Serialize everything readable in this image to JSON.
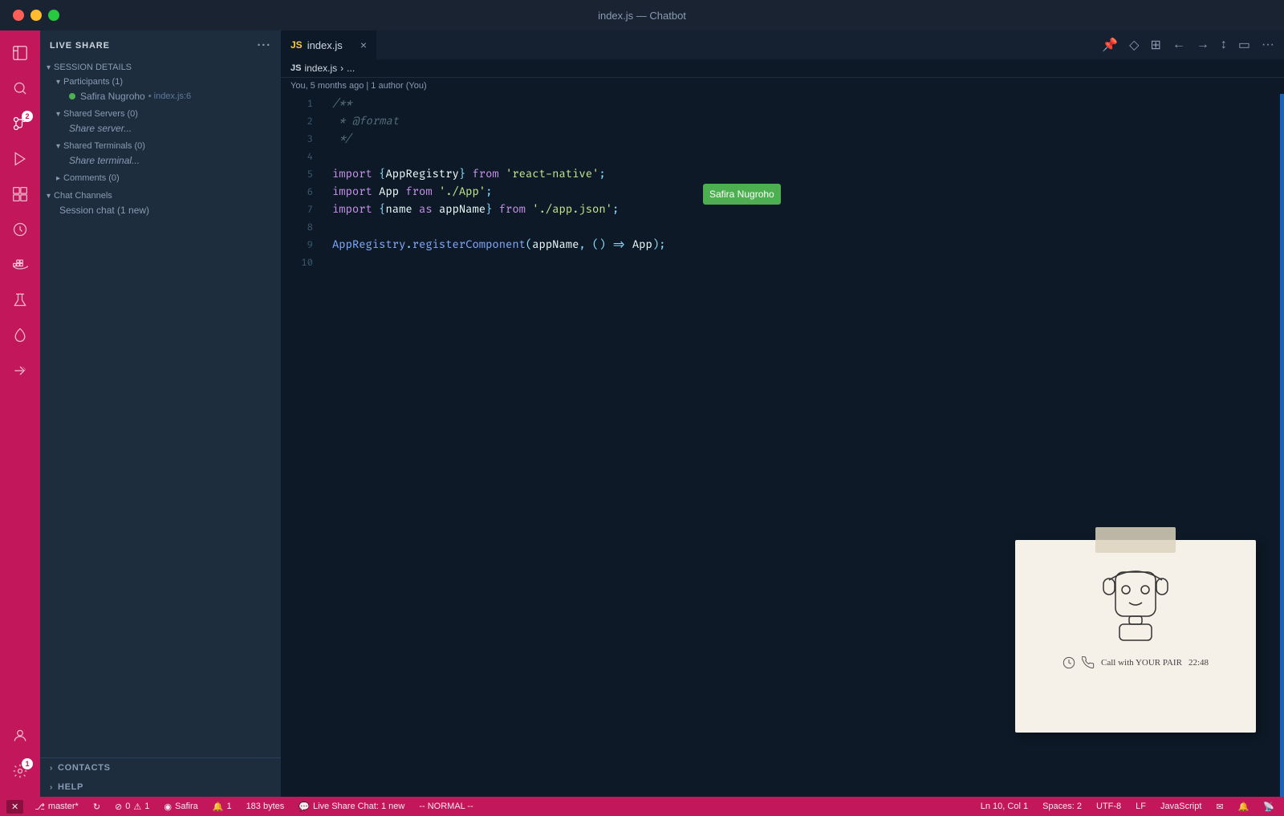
{
  "titleBar": {
    "title": "index.js — Chatbot"
  },
  "activityBar": {
    "icons": [
      {
        "name": "files-icon",
        "symbol": "⧉",
        "active": false
      },
      {
        "name": "search-icon",
        "symbol": "🔍",
        "active": false
      },
      {
        "name": "source-control-icon",
        "symbol": "⑂",
        "active": true,
        "badge": "2"
      },
      {
        "name": "run-icon",
        "symbol": "▷",
        "active": false
      },
      {
        "name": "extensions-icon",
        "symbol": "⊞",
        "active": false
      },
      {
        "name": "timer-icon",
        "symbol": "⏱",
        "active": false
      },
      {
        "name": "docker-icon",
        "symbol": "🐳",
        "active": false
      },
      {
        "name": "flask-icon",
        "symbol": "⚗",
        "active": false
      },
      {
        "name": "leaf-icon",
        "symbol": "🌿",
        "active": false
      },
      {
        "name": "liveshare-icon",
        "symbol": "↗",
        "active": false
      }
    ],
    "bottomIcons": [
      {
        "name": "account-icon",
        "symbol": "👤"
      },
      {
        "name": "settings-icon",
        "symbol": "⚙",
        "badge": "1"
      }
    ]
  },
  "sidebar": {
    "header": {
      "title": "LIVE SHARE",
      "moreIcon": "···"
    },
    "sections": [
      {
        "name": "session-details",
        "label": "SESSION DETAILS",
        "expanded": true,
        "children": [
          {
            "name": "participants",
            "label": "Participants (1)",
            "expanded": true,
            "children": [
              {
                "name": "safira",
                "label": "Safira Nugroho",
                "sublabel": "index.js:6",
                "hasDot": true
              }
            ]
          },
          {
            "name": "shared-servers",
            "label": "Shared Servers (0)",
            "expanded": false,
            "children": [
              {
                "name": "share-server",
                "label": "Share server..."
              }
            ]
          },
          {
            "name": "shared-terminals",
            "label": "Shared Terminals (0)",
            "expanded": false,
            "children": [
              {
                "name": "share-terminal",
                "label": "Share terminal..."
              }
            ]
          },
          {
            "name": "comments",
            "label": "Comments (0)",
            "expanded": false,
            "children": []
          }
        ]
      },
      {
        "name": "chat-channels",
        "label": "Chat Channels",
        "expanded": true,
        "children": [
          {
            "name": "session-chat",
            "label": "Session chat (1 new)"
          }
        ]
      }
    ],
    "bottom": {
      "contacts": "CONTACTS",
      "help": "HELP"
    }
  },
  "editor": {
    "tab": {
      "fileIcon": "{}",
      "filename": "index.js",
      "filepath": "index.js",
      "breadcrumbSep": "›",
      "breadcrumbMore": "..."
    },
    "gitBlame": "You, 5 months ago | 1 author (You)",
    "lines": [
      {
        "num": 1,
        "content": "/**"
      },
      {
        "num": 2,
        "content": " * @format"
      },
      {
        "num": 3,
        "content": " */"
      },
      {
        "num": 4,
        "content": ""
      },
      {
        "num": 5,
        "content": "import {AppRegistry} from 'react-native';"
      },
      {
        "num": 6,
        "content": "import App from './App';"
      },
      {
        "num": 7,
        "content": "import {name as appName} from './app.json';"
      },
      {
        "num": 8,
        "content": ""
      },
      {
        "num": 9,
        "content": "AppRegistry.registerComponent(appName, () => App);"
      },
      {
        "num": 10,
        "content": ""
      }
    ],
    "tooltip": {
      "text": "Safira Nugroho",
      "line": 6
    }
  },
  "illustration": {
    "caption": "Call with YOUR PAIR",
    "time": "22:48"
  },
  "statusBar": {
    "branch": "master*",
    "syncIcon": "↻",
    "errors": "0",
    "warnings": "1",
    "user": "Safira",
    "notifications": "1",
    "fileSize": "183 bytes",
    "liveShare": "Live Share Chat: 1 new",
    "vimMode": "-- NORMAL --",
    "position": "Ln 10, Col 1",
    "spaces": "Spaces: 2",
    "encoding": "UTF-8",
    "lineEnding": "LF",
    "language": "JavaScript",
    "feedbackIcon": "✉",
    "bellIcon": "🔔",
    "broadcastIcon": "📡"
  }
}
